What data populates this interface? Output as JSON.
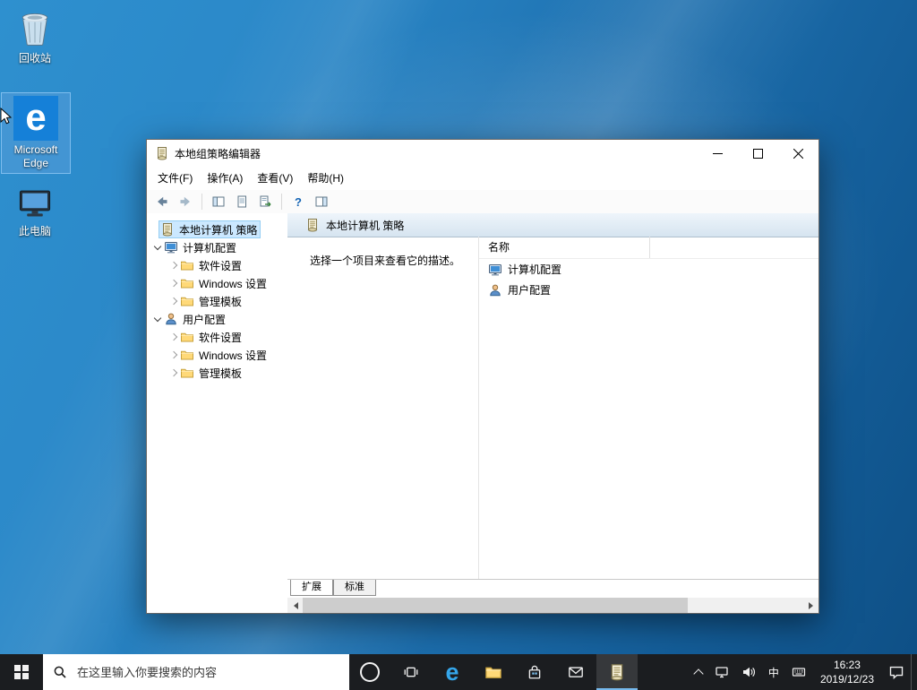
{
  "colors": {
    "taskbar_accent": "#76b9ed",
    "taskbar_bg": "#1b1d20",
    "tree_selection": "#cbe8ff",
    "desktop_blue_light": "#2e90cf",
    "desktop_blue_dark": "#0e4f85",
    "edge_tile_blue": "#1580d8"
  },
  "desktop": {
    "icons": {
      "recycle_bin": "回收站",
      "edge": "Microsoft Edge",
      "this_pc": "此电脑"
    }
  },
  "window": {
    "title": "本地组策略编辑器",
    "menu": [
      "文件(F)",
      "操作(A)",
      "查看(V)",
      "帮助(H)"
    ],
    "toolbar": {
      "help_glyph": "?"
    },
    "tree": {
      "items": [
        {
          "label": "本地计算机 策略",
          "icon": "policy-scroll",
          "selected": true
        },
        {
          "label": "计算机配置",
          "icon": "computer",
          "expanded": true
        },
        {
          "label": "软件设置",
          "icon": "folder"
        },
        {
          "label": "Windows 设置",
          "icon": "folder"
        },
        {
          "label": "管理模板",
          "icon": "folder"
        },
        {
          "label": "用户配置",
          "icon": "user",
          "expanded": true
        },
        {
          "label": "软件设置",
          "icon": "folder"
        },
        {
          "label": "Windows 设置",
          "icon": "folder"
        },
        {
          "label": "管理模板",
          "icon": "folder"
        }
      ]
    },
    "content": {
      "header": "本地计算机 策略",
      "description": "选择一个项目来查看它的描述。",
      "name_column": "名称",
      "items": [
        {
          "label": "计算机配置",
          "icon": "computer"
        },
        {
          "label": "用户配置",
          "icon": "user"
        }
      ]
    },
    "tabs": [
      "扩展",
      "标准"
    ]
  },
  "taskbar": {
    "search_placeholder": "在这里输入你要搜索的内容",
    "ime_indicator": "中",
    "time": "16:23",
    "date": "2019/12/23"
  }
}
